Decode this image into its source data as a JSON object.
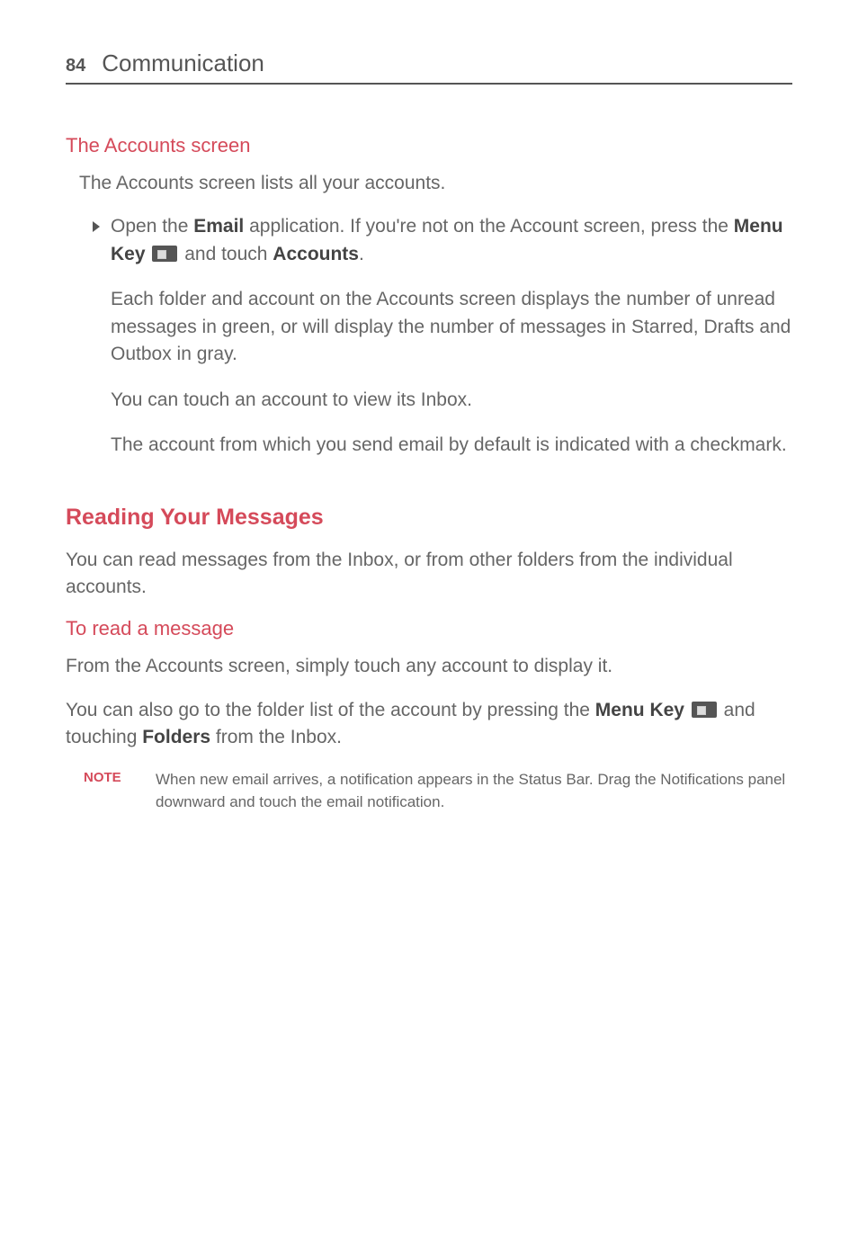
{
  "header": {
    "page_number": "84",
    "title": "Communication"
  },
  "section1": {
    "heading": "The Accounts screen",
    "intro": "The Accounts screen lists all your accounts.",
    "bullet": {
      "p1_pre": "Open the ",
      "p1_bold1": "Email",
      "p1_mid": " application. If you're not on the Account screen, press the ",
      "p1_bold2": "Menu Key",
      "p1_mid2": " and touch ",
      "p1_bold3": "Accounts",
      "p1_end": ".",
      "p2": "Each folder and account on the Accounts screen displays the number of unread messages in green, or will display the number of messages in Starred, Drafts and Outbox in gray.",
      "p3": "You can touch an account to view its Inbox.",
      "p4": "The account from which you send email by default is indicated with a checkmark."
    }
  },
  "section2": {
    "heading": "Reading Your Messages",
    "p1": "You can read messages from the Inbox, or from other folders from the individual accounts."
  },
  "section3": {
    "heading": "To read a message",
    "p1": "From the Accounts screen, simply touch any account to display it.",
    "p2_pre": "You can also go to the folder list of the account by pressing the ",
    "p2_bold1": "Menu Key",
    "p2_mid": " and touching ",
    "p2_bold2": "Folders",
    "p2_end": " from the Inbox."
  },
  "note": {
    "label": "NOTE",
    "text": "When new email arrives, a notification appears in the Status Bar. Drag the Notifications panel downward and touch the email notification."
  }
}
